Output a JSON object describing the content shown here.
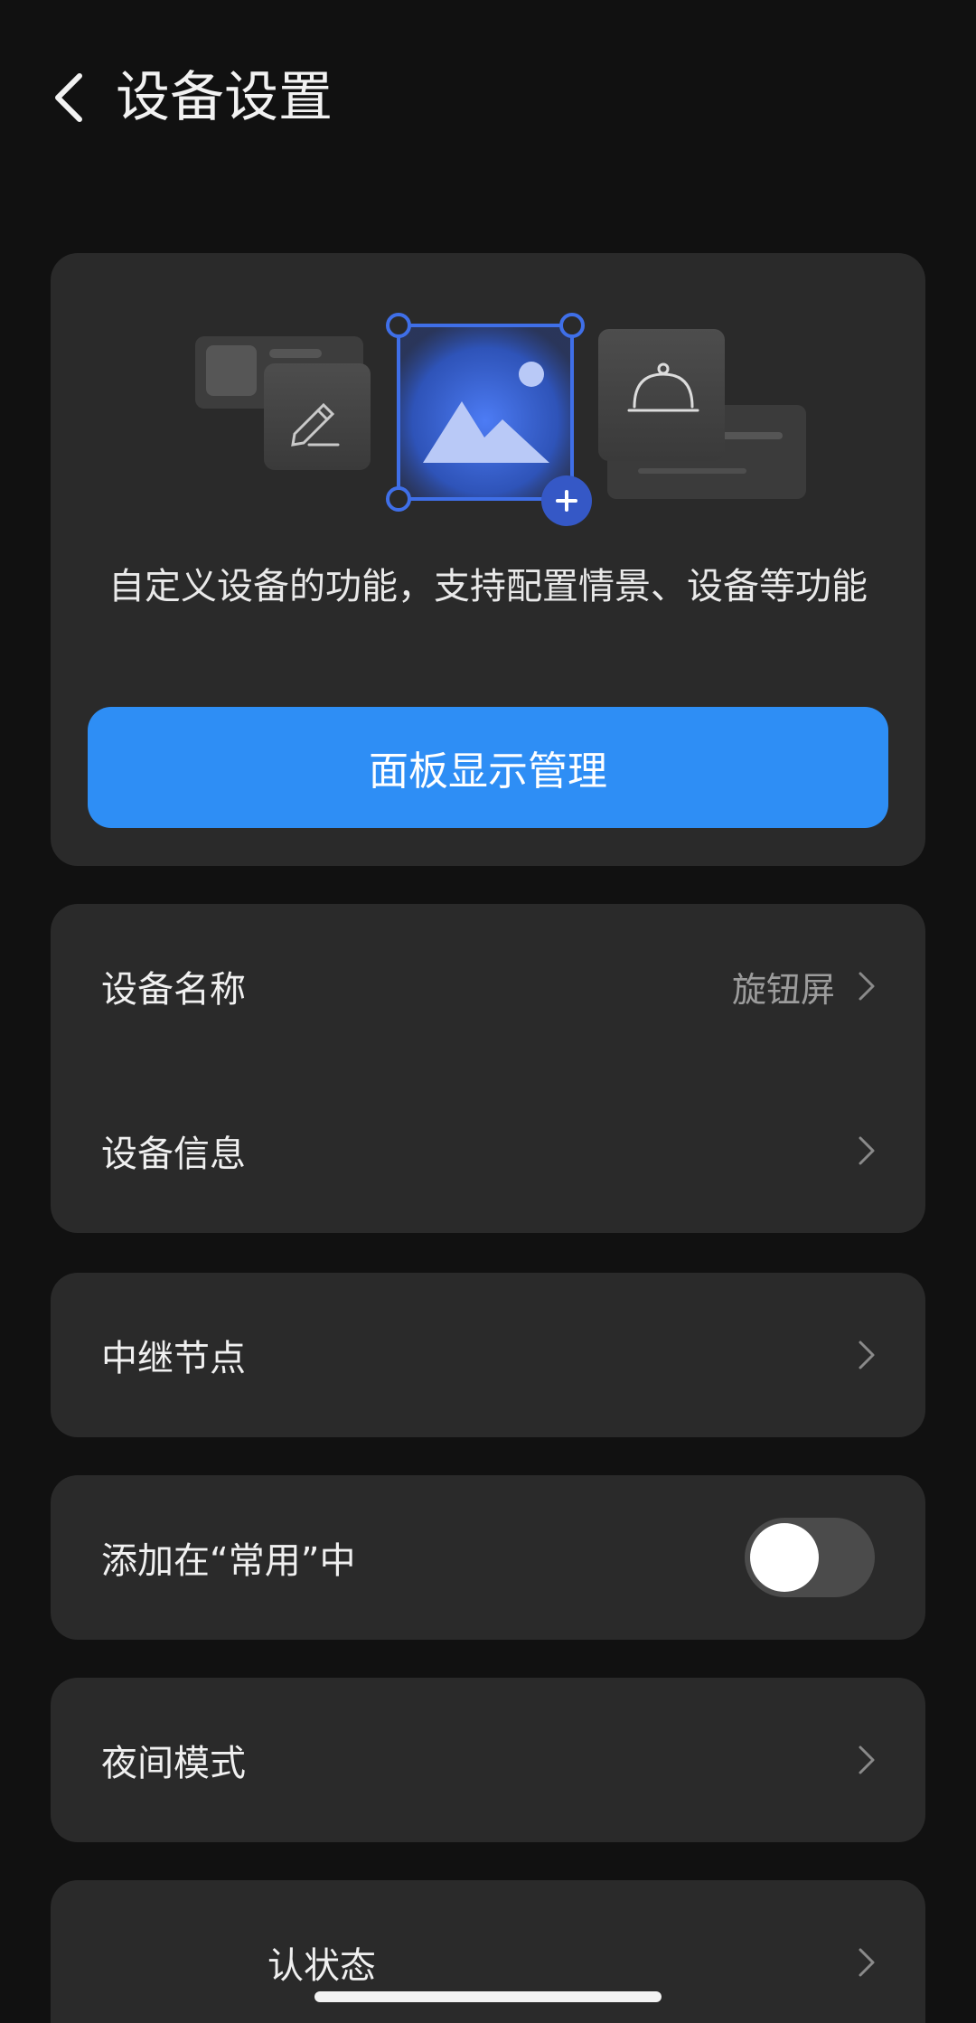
{
  "header": {
    "title": "设备设置"
  },
  "hero": {
    "description": "自定义设备的功能，支持配置情景、设备等功能",
    "button_label": "面板显示管理"
  },
  "device_group": {
    "name_row": {
      "label": "设备名称",
      "value": "旋钮屏"
    },
    "info_row": {
      "label": "设备信息"
    }
  },
  "relay_row": {
    "label": "中继节点"
  },
  "favorite_row": {
    "label": "添加在“常用”中",
    "enabled": false
  },
  "night_row": {
    "label": "夜间模式"
  },
  "partial_row": {
    "label": "认状态"
  },
  "colors": {
    "background": "#111111",
    "card": "#2a2a2a",
    "accent": "#2e8ef5",
    "secondary_text": "#9c9c9c"
  }
}
